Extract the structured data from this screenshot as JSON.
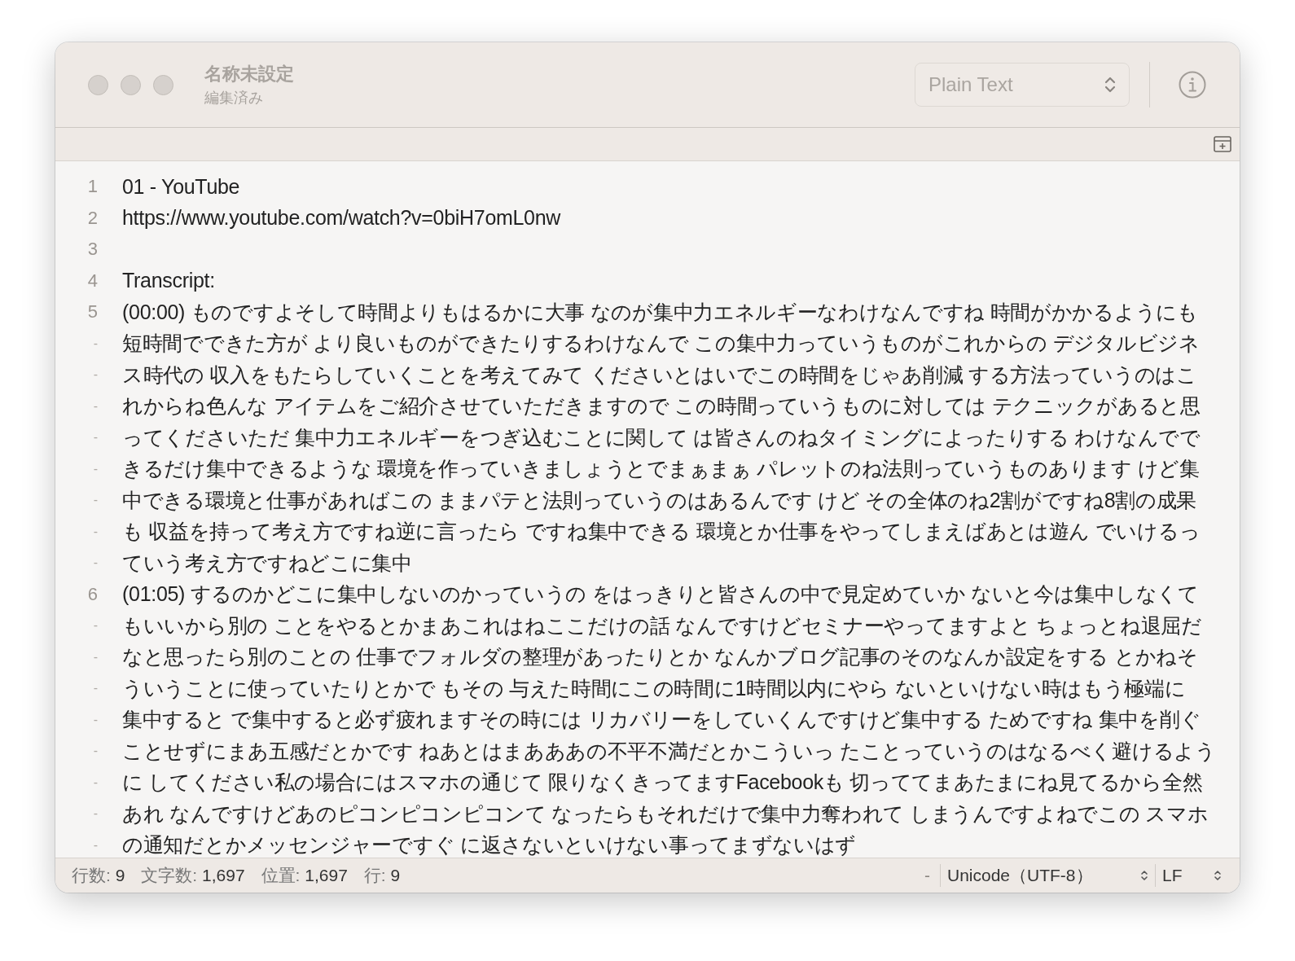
{
  "window": {
    "title": "名称未設定",
    "subtitle": "編集済み"
  },
  "toolbar": {
    "syntax_menu": "Plain Text"
  },
  "editor": {
    "lines": [
      {
        "number": "1",
        "segments": [
          "01 - YouTube"
        ]
      },
      {
        "number": "2",
        "segments": [
          "https://www.youtube.com/watch?v=0biH7omL0nw"
        ]
      },
      {
        "number": "3"
      },
      {
        "number": "4",
        "segments": [
          "Transcript:"
        ]
      },
      {
        "number": "5",
        "wrap_mark": "-",
        "segments": [
          "(00:00) ものですよそして時間よりもはるかに大事 なのが集中力エネルギーなわけなんですね 時間がかかるようにも",
          "短時間でできた方が より良いものができたりするわけなんで この集中力っていうものがこれからの デジタルビジネ",
          "ス時代の 収入をもたらしていくことを考えてみて くださいとはいでこの時間をじゃあ削減 する方法っていうのはこ",
          "れからね色んな アイテムをご紹介させていただきますので この時間っていうものに対しては テクニックがあると思",
          "ってくださいただ 集中力エネルギーをつぎ込むことに関して は皆さんのねタイミングによったりする わけなんでで",
          "きるだけ集中できるような 環境を作っていきましょうとでまぁまぁ パレットのね法則っていうものあります けど集",
          "中できる環境と仕事があればこの ままパテと法則っていうのはあるんです けど その全体のね2割がですね8割の成果",
          "も 収益を持って考え方ですね逆に言ったら ですね集中できる 環境とか仕事をやってしまえばあとは遊ん でいけるっ",
          "ていう考え方ですねどこに集中"
        ]
      },
      {
        "number": "6",
        "wrap_mark": "-",
        "segments": [
          "(01:05) するのかどこに集中しないのかっていうの をはっきりと皆さんの中で見定めていか ないと今は集中しなくて",
          "もいいから別の ことをやるとかまあこれはねここだけの話 なんですけどセミナーやってますよと ちょっとね退屈だ",
          "なと思ったら別のことの 仕事でフォルダの整理があったりとか なんかブログ記事のそのなんか設定をする とかねそ",
          "ういうことに使っていたりとかで もその 与えた時間にこの時間に1時間以内にやら ないといけない時はもう極端に",
          "集中すると で集中すると必ず疲れますその時には リカバリーをしていくんですけど集中する ためですね 集中を削ぐ",
          "ことせずにまあ五感だとかです ねあとはまあああの不平不満だとかこういっ たことっていうのはなるべく避けるよう",
          "に してください私の場合にはスマホの通じて 限りなくきってますFacebookも 切っててまあたまにね見てるから全然",
          "あれ なんですけどあのピコンピコンピコンて なったらもそれだけで集中力奪われて しまうんですよねでこの スマホ",
          "の通知だとかメッセンジャーですぐ に返さないといけない事ってまずないはず"
        ]
      }
    ]
  },
  "status_bar": {
    "items": [
      {
        "label": "行数:",
        "value": "9"
      },
      {
        "label": "文字数:",
        "value": "1,697"
      },
      {
        "label": "位置:",
        "value": "1,697"
      },
      {
        "label": "行:",
        "value": "9"
      }
    ],
    "dash": "-",
    "encoding": "Unicode（UTF-8）",
    "line_ending": "LF"
  }
}
